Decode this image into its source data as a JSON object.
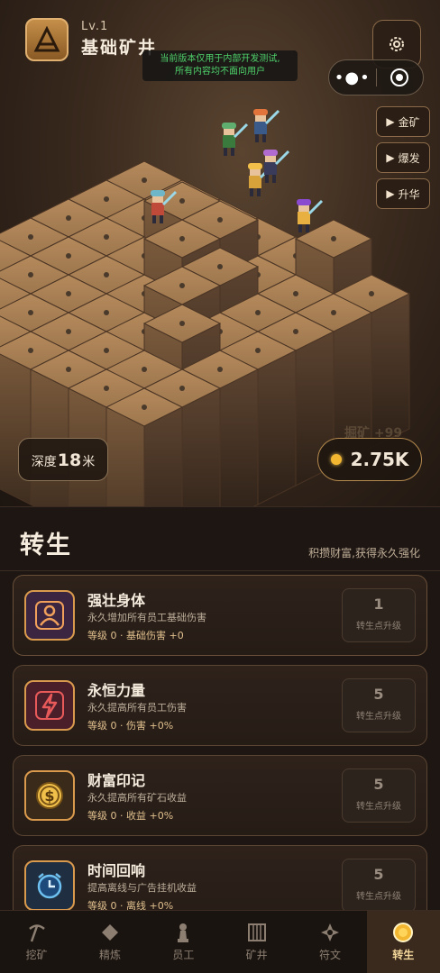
{
  "header": {
    "level": "Lv.1",
    "mine_name": "基础矿井",
    "notice_line1": "当前版本仅用于内部开发测试,",
    "notice_line2": "所有内容均不面向用户"
  },
  "side_buttons": [
    "金矿",
    "爆发",
    "升华"
  ],
  "depth": {
    "prefix": "深度",
    "value": "18",
    "unit": "米"
  },
  "ghost_text": "掘矿 +99",
  "gold": {
    "amount": "2.75K"
  },
  "panel": {
    "title": "转生",
    "subtitle": "积攒财富,获得永久强化",
    "upgrade_label": "转生点升级",
    "cards": [
      {
        "icon": "person-icon",
        "title": "强壮身体",
        "desc": "永久增加所有员工基础伤害",
        "stat": "等级 0 · 基础伤害 +0",
        "cost": "1"
      },
      {
        "icon": "lightning-icon",
        "title": "永恒力量",
        "desc": "永久提高所有员工伤害",
        "stat": "等级 0 · 伤害 +0%",
        "cost": "5"
      },
      {
        "icon": "dollar-coin-icon",
        "title": "财富印记",
        "desc": "永久提高所有矿石收益",
        "stat": "等级 0 · 收益 +0%",
        "cost": "5"
      },
      {
        "icon": "alarm-clock-icon",
        "title": "时间回响",
        "desc": "提高离线与广告挂机收益",
        "stat": "等级 0 · 离线 +0%",
        "cost": "5"
      }
    ]
  },
  "nav": [
    {
      "label": "挖矿",
      "icon": "pickaxe-icon"
    },
    {
      "label": "精炼",
      "icon": "diamond-icon"
    },
    {
      "label": "员工",
      "icon": "pawn-icon"
    },
    {
      "label": "矿井",
      "icon": "mine-shaft-icon"
    },
    {
      "label": "符文",
      "icon": "rune-icon"
    },
    {
      "label": "转生",
      "icon": "coin-icon",
      "active": true
    }
  ],
  "colors": {
    "accent_gold": "#f2b631",
    "notice_green": "#4fd36b",
    "card_border": "#d99a4e"
  }
}
